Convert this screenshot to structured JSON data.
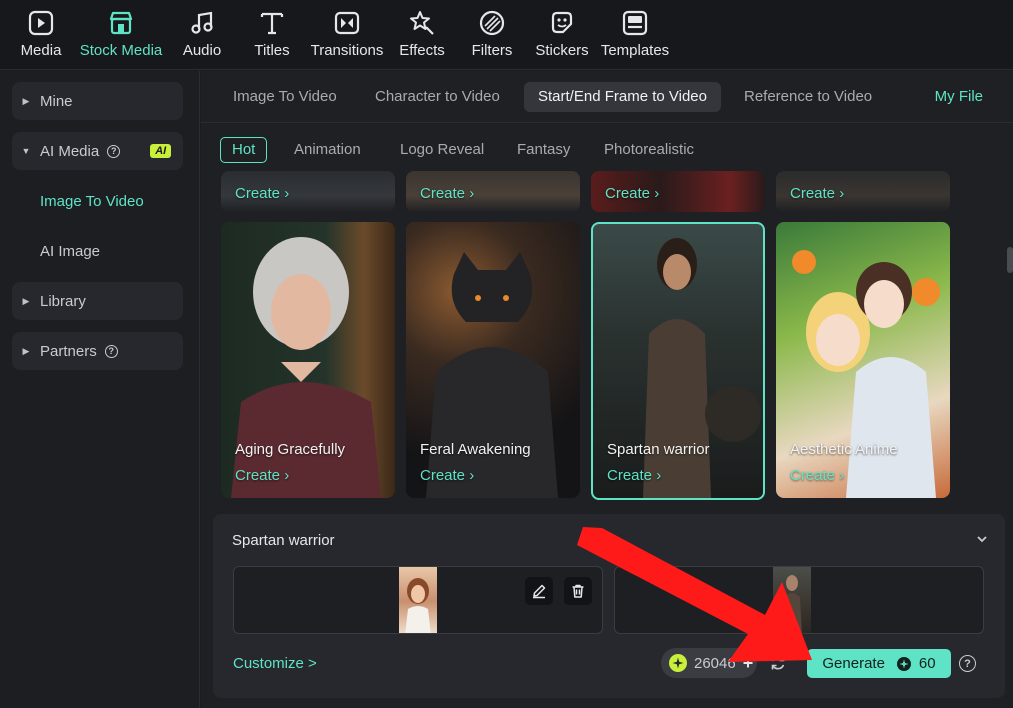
{
  "toolbar": {
    "items": [
      {
        "label": "Media",
        "icon": "media-icon"
      },
      {
        "label": "Stock Media",
        "icon": "stock-media-icon"
      },
      {
        "label": "Audio",
        "icon": "audio-icon"
      },
      {
        "label": "Titles",
        "icon": "titles-icon"
      },
      {
        "label": "Transitions",
        "icon": "transitions-icon"
      },
      {
        "label": "Effects",
        "icon": "effects-icon"
      },
      {
        "label": "Filters",
        "icon": "filters-icon"
      },
      {
        "label": "Stickers",
        "icon": "stickers-icon"
      },
      {
        "label": "Templates",
        "icon": "templates-icon"
      }
    ],
    "active": "Stock Media"
  },
  "sidebar": {
    "mine": "Mine",
    "ai_media": "AI Media",
    "ai_badge": "AI",
    "image_to_video": "Image To Video",
    "ai_image": "AI Image",
    "library": "Library",
    "partners": "Partners"
  },
  "tabs": {
    "items": [
      "Image To Video",
      "Character to Video",
      "Start/End Frame to Video",
      "Reference to Video"
    ],
    "active": "Start/End Frame to Video",
    "my_file": "My File"
  },
  "chips": {
    "items": [
      "Hot",
      "Animation",
      "Logo Reveal",
      "Fantasy",
      "Photorealistic"
    ],
    "active": "Hot"
  },
  "cards": {
    "create_label": "Create",
    "items": [
      {
        "title": "Aging Gracefully"
      },
      {
        "title": "Feral Awakening"
      },
      {
        "title": "Spartan warrior",
        "selected": true
      },
      {
        "title": "Aesthetic Anime"
      }
    ]
  },
  "panel": {
    "title": "Spartan warrior",
    "customize": "Customize >",
    "credits": "26046",
    "generate": "Generate",
    "generate_cost": "60"
  },
  "colors": {
    "accent": "#5fe3c7",
    "ai_badge": "#c8f03a",
    "annotation_arrow": "#ff1a1a"
  }
}
